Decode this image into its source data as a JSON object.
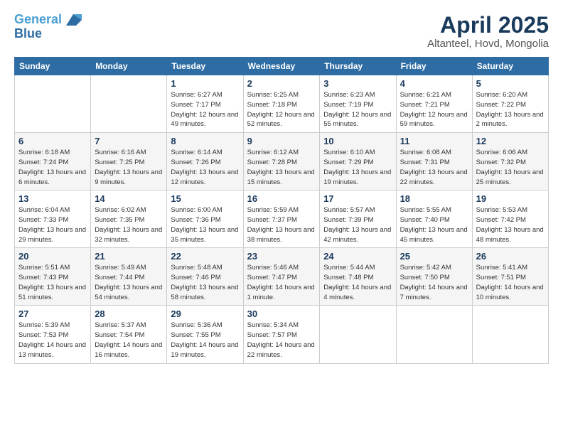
{
  "logo": {
    "line1": "General",
    "line2": "Blue"
  },
  "header": {
    "month": "April 2025",
    "location": "Altanteel, Hovd, Mongolia"
  },
  "weekdays": [
    "Sunday",
    "Monday",
    "Tuesday",
    "Wednesday",
    "Thursday",
    "Friday",
    "Saturday"
  ],
  "weeks": [
    [
      {
        "day": null
      },
      {
        "day": null
      },
      {
        "day": "1",
        "sunrise": "6:27 AM",
        "sunset": "7:17 PM",
        "daylight": "12 hours and 49 minutes."
      },
      {
        "day": "2",
        "sunrise": "6:25 AM",
        "sunset": "7:18 PM",
        "daylight": "12 hours and 52 minutes."
      },
      {
        "day": "3",
        "sunrise": "6:23 AM",
        "sunset": "7:19 PM",
        "daylight": "12 hours and 55 minutes."
      },
      {
        "day": "4",
        "sunrise": "6:21 AM",
        "sunset": "7:21 PM",
        "daylight": "12 hours and 59 minutes."
      },
      {
        "day": "5",
        "sunrise": "6:20 AM",
        "sunset": "7:22 PM",
        "daylight": "13 hours and 2 minutes."
      }
    ],
    [
      {
        "day": "6",
        "sunrise": "6:18 AM",
        "sunset": "7:24 PM",
        "daylight": "13 hours and 6 minutes."
      },
      {
        "day": "7",
        "sunrise": "6:16 AM",
        "sunset": "7:25 PM",
        "daylight": "13 hours and 9 minutes."
      },
      {
        "day": "8",
        "sunrise": "6:14 AM",
        "sunset": "7:26 PM",
        "daylight": "13 hours and 12 minutes."
      },
      {
        "day": "9",
        "sunrise": "6:12 AM",
        "sunset": "7:28 PM",
        "daylight": "13 hours and 15 minutes."
      },
      {
        "day": "10",
        "sunrise": "6:10 AM",
        "sunset": "7:29 PM",
        "daylight": "13 hours and 19 minutes."
      },
      {
        "day": "11",
        "sunrise": "6:08 AM",
        "sunset": "7:31 PM",
        "daylight": "13 hours and 22 minutes."
      },
      {
        "day": "12",
        "sunrise": "6:06 AM",
        "sunset": "7:32 PM",
        "daylight": "13 hours and 25 minutes."
      }
    ],
    [
      {
        "day": "13",
        "sunrise": "6:04 AM",
        "sunset": "7:33 PM",
        "daylight": "13 hours and 29 minutes."
      },
      {
        "day": "14",
        "sunrise": "6:02 AM",
        "sunset": "7:35 PM",
        "daylight": "13 hours and 32 minutes."
      },
      {
        "day": "15",
        "sunrise": "6:00 AM",
        "sunset": "7:36 PM",
        "daylight": "13 hours and 35 minutes."
      },
      {
        "day": "16",
        "sunrise": "5:59 AM",
        "sunset": "7:37 PM",
        "daylight": "13 hours and 38 minutes."
      },
      {
        "day": "17",
        "sunrise": "5:57 AM",
        "sunset": "7:39 PM",
        "daylight": "13 hours and 42 minutes."
      },
      {
        "day": "18",
        "sunrise": "5:55 AM",
        "sunset": "7:40 PM",
        "daylight": "13 hours and 45 minutes."
      },
      {
        "day": "19",
        "sunrise": "5:53 AM",
        "sunset": "7:42 PM",
        "daylight": "13 hours and 48 minutes."
      }
    ],
    [
      {
        "day": "20",
        "sunrise": "5:51 AM",
        "sunset": "7:43 PM",
        "daylight": "13 hours and 51 minutes."
      },
      {
        "day": "21",
        "sunrise": "5:49 AM",
        "sunset": "7:44 PM",
        "daylight": "13 hours and 54 minutes."
      },
      {
        "day": "22",
        "sunrise": "5:48 AM",
        "sunset": "7:46 PM",
        "daylight": "13 hours and 58 minutes."
      },
      {
        "day": "23",
        "sunrise": "5:46 AM",
        "sunset": "7:47 PM",
        "daylight": "14 hours and 1 minute."
      },
      {
        "day": "24",
        "sunrise": "5:44 AM",
        "sunset": "7:48 PM",
        "daylight": "14 hours and 4 minutes."
      },
      {
        "day": "25",
        "sunrise": "5:42 AM",
        "sunset": "7:50 PM",
        "daylight": "14 hours and 7 minutes."
      },
      {
        "day": "26",
        "sunrise": "5:41 AM",
        "sunset": "7:51 PM",
        "daylight": "14 hours and 10 minutes."
      }
    ],
    [
      {
        "day": "27",
        "sunrise": "5:39 AM",
        "sunset": "7:53 PM",
        "daylight": "14 hours and 13 minutes."
      },
      {
        "day": "28",
        "sunrise": "5:37 AM",
        "sunset": "7:54 PM",
        "daylight": "14 hours and 16 minutes."
      },
      {
        "day": "29",
        "sunrise": "5:36 AM",
        "sunset": "7:55 PM",
        "daylight": "14 hours and 19 minutes."
      },
      {
        "day": "30",
        "sunrise": "5:34 AM",
        "sunset": "7:57 PM",
        "daylight": "14 hours and 22 minutes."
      },
      {
        "day": null
      },
      {
        "day": null
      },
      {
        "day": null
      }
    ]
  ]
}
